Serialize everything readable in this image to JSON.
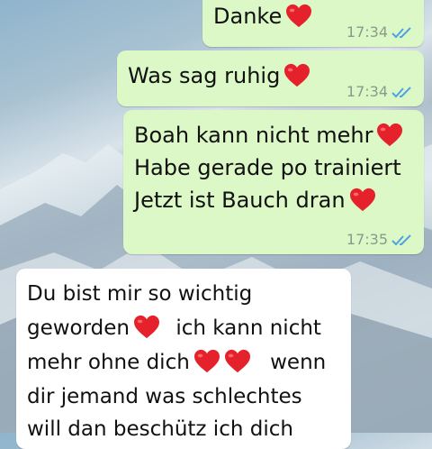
{
  "colors": {
    "outgoing_bubble": "#dcf8c6",
    "incoming_bubble": "#ffffff",
    "read_ticks": "#4fa3e0",
    "heart": "#e5222b"
  },
  "messages": [
    {
      "direction": "outgoing",
      "lines": [
        "Danke"
      ],
      "emoji_after": [
        "heart-emoji"
      ],
      "time": "17:34",
      "status": "read-double-check-icon"
    },
    {
      "direction": "outgoing",
      "lines": [
        "Was sag ruhig"
      ],
      "emoji_after": [
        "heart-emoji"
      ],
      "time": "17:34",
      "status": "read-double-check-icon"
    },
    {
      "direction": "outgoing",
      "lines": [
        "Boah kann nicht mehr",
        "Habe gerade po trainiert",
        "Jetzt ist Bauch dran"
      ],
      "time": "17:35",
      "status": "read-double-check-icon"
    },
    {
      "direction": "incoming",
      "lines": [
        "Du bist mir so wichtig",
        "geworden",
        "ich kann nicht",
        "mehr ohne dich",
        "wenn",
        "dir jemand was schlechtes",
        "will dan beschütz ich dich"
      ]
    }
  ]
}
